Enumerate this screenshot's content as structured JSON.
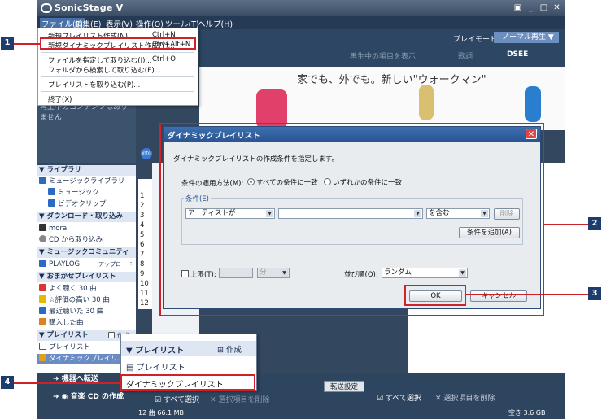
{
  "app": {
    "title": "SonicStage V"
  },
  "menubar": [
    "ファイル(F)",
    "編集(E)",
    "表示(V)",
    "操作(O)",
    "ツール(T)",
    "ヘルプ(H)"
  ],
  "toolbar": {
    "playmode_label": "プレイモード",
    "playmode_value": "ノーマル再生",
    "play_item": "再生中の項目を表示",
    "kaishi": "歌詞",
    "dsee": "DSEE"
  },
  "file_menu": {
    "items": [
      {
        "label": "新規プレイリスト作成(N)...",
        "shortcut": "Ctrl+N"
      },
      {
        "label": "新規ダイナミックプレイリスト作成(Y)...",
        "shortcut": "Ctrl+Alt+N"
      },
      {
        "label": "ファイルを指定して取り込む(I)...",
        "shortcut": "Ctrl+O"
      },
      {
        "label": "フォルダから検索して取り込む(E)...",
        "shortcut": ""
      },
      {
        "label": "プレイリストを取り込む(P)...",
        "shortcut": ""
      },
      {
        "label": "終了(X)",
        "shortcut": ""
      }
    ]
  },
  "banner": {
    "text": "家でも、外でも。新しい\"ウォークマン\""
  },
  "left_pane": {
    "nowplaying": "再生中のコンテンツはありません"
  },
  "library": {
    "sections": [
      {
        "header": "▼ ライブラリ",
        "items": [
          "ミュージックライブラリ",
          "ミュージック",
          "ビデオクリップ"
        ]
      },
      {
        "header": "▼ ダウンロード・取り込み",
        "items": [
          "mora",
          "CD から取り込み"
        ]
      },
      {
        "header": "▼ ミュージックコミュニティ",
        "items": [
          "PLAYLOG"
        ]
      },
      {
        "header": "▼ おまかせプレイリスト",
        "items": [
          "よく聴く 30 曲",
          "☆評価の高い 30 曲",
          "最近聴いた 30 曲",
          "購入した曲"
        ]
      },
      {
        "header": "▼ プレイリスト",
        "items": [
          "プレイリスト",
          "ダイナミックプレイリ..."
        ]
      }
    ],
    "upload": "アップロード",
    "create_btn": "作成"
  },
  "track_numbers": [
    "1",
    "2",
    "3",
    "4",
    "5",
    "6",
    "7",
    "8",
    "9",
    "10",
    "11",
    "12"
  ],
  "dialog": {
    "title": "ダイナミックプレイリスト",
    "instruction": "ダイナミックプレイリストの作成条件を指定します。",
    "apply_label": "条件の適用方法(M):",
    "radio_all": "すべての条件に一致",
    "radio_any": "いずれかの条件に一致",
    "condition_group": "条件(E)",
    "field_select": "アーティストが",
    "operator_select": "を含む",
    "delete_btn": "削除",
    "add_condition_btn": "条件を追加(A)",
    "limit_label": "上限(T):",
    "limit_unit": "分",
    "sort_label": "並び順(O):",
    "sort_value": "ランダム",
    "ok_btn": "OK",
    "cancel_btn": "キャンセル"
  },
  "popup": {
    "header": "▼ プレイリスト",
    "create": "作成",
    "item1": "プレイリスト",
    "item2": "ダイナミックプレイリスト",
    "under": "購入した曲"
  },
  "bottom": {
    "transfer_btn": "機器へ転送",
    "cd_btn": "音楽 CD の作成",
    "select_all": "すべて選択",
    "delete_sel": "選択項目を削除",
    "transfer_settings": "転送設定",
    "status_left": "12 曲 66.1 MB",
    "status_right": "空き 3.6 GB"
  },
  "callouts": [
    "1",
    "2",
    "3",
    "4"
  ]
}
